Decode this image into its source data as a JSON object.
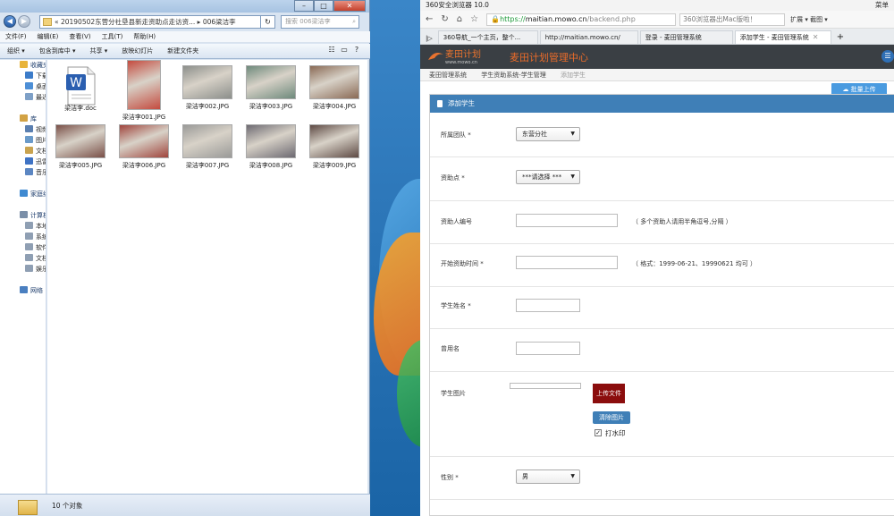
{
  "explorer": {
    "address_path": "« 20190502东营分社垦县新走资助点走访资... ▸ 006梁洁李",
    "search_placeholder": "搜索 006梁洁李",
    "menu": [
      "文件(F)",
      "编辑(E)",
      "查看(V)",
      "工具(T)",
      "帮助(H)"
    ],
    "toolbar": [
      "组织 ▾",
      "包含到库中 ▾",
      "共享 ▾",
      "放映幻灯片",
      "新建文件夹"
    ],
    "nav": [
      {
        "label": "收藏夹",
        "group": true,
        "color": "#e8b43a"
      },
      {
        "label": "下载",
        "group": false,
        "color": "#3c7cc9"
      },
      {
        "label": "桌面",
        "group": false,
        "color": "#4d8fd6"
      },
      {
        "label": "最近",
        "group": false,
        "color": "#7ea0c7"
      },
      {
        "label": "",
        "group": false,
        "color": "transparent"
      },
      {
        "label": "库",
        "group": true,
        "color": "#d2a244"
      },
      {
        "label": "视频",
        "group": false,
        "color": "#5a7fb0"
      },
      {
        "label": "图片",
        "group": false,
        "color": "#6a9ac9"
      },
      {
        "label": "文档",
        "group": false,
        "color": "#c9a34f"
      },
      {
        "label": "迅雷",
        "group": false,
        "color": "#3f73c4"
      },
      {
        "label": "音乐",
        "group": false,
        "color": "#5b86c2"
      },
      {
        "label": "",
        "group": false,
        "color": "transparent"
      },
      {
        "label": "家庭组",
        "group": true,
        "color": "#3f8ad1"
      },
      {
        "label": "",
        "group": false,
        "color": "transparent"
      },
      {
        "label": "计算机",
        "group": true,
        "color": "#7b8fa8"
      },
      {
        "label": "本地",
        "group": false,
        "color": "#8f9fb3"
      },
      {
        "label": "系统",
        "group": false,
        "color": "#8f9fb3"
      },
      {
        "label": "软件",
        "group": false,
        "color": "#8f9fb3"
      },
      {
        "label": "文档",
        "group": false,
        "color": "#8f9fb3"
      },
      {
        "label": "娱乐",
        "group": false,
        "color": "#8f9fb3"
      },
      {
        "label": "",
        "group": false,
        "color": "transparent"
      },
      {
        "label": "网络",
        "group": true,
        "color": "#4a7fc0"
      }
    ],
    "files": [
      {
        "name": "梁洁李.doc",
        "kind": "doc"
      },
      {
        "name": "梁洁李001.JPG",
        "kind": "photo",
        "color": "#c44b3f"
      },
      {
        "name": "梁洁李002.JPG",
        "kind": "photo",
        "color": "#8c8f8b"
      },
      {
        "name": "梁洁李003.JPG",
        "kind": "photo",
        "color": "#6e8a7c"
      },
      {
        "name": "梁洁李004.JPG",
        "kind": "photo",
        "color": "#8a6a55"
      },
      {
        "name": "梁洁李005.JPG",
        "kind": "photo",
        "color": "#7a5048"
      },
      {
        "name": "梁洁李006.JPG",
        "kind": "photo",
        "color": "#a0453d"
      },
      {
        "name": "梁洁李007.JPG",
        "kind": "photo",
        "color": "#9a9a98"
      },
      {
        "name": "梁洁李008.JPG",
        "kind": "photo",
        "color": "#6d6a72"
      },
      {
        "name": "梁洁李009.JPG",
        "kind": "photo",
        "color": "#5e4a44"
      }
    ],
    "status": "10 个对象"
  },
  "browser": {
    "title": "360安全浏览器 10.0",
    "title_right": "菜单",
    "url_scheme": "https://",
    "url_domain": "maitian.mowo.cn",
    "url_path": "/backend.php",
    "search_text": "360浏览器出Mac版啦！",
    "ext_text": "扩展 ▾  截图 ▾",
    "tabs": [
      "360导航_一个主页，整个...",
      "http://maitian.mowo.cn/",
      "登录 - 麦田管理系统",
      "添加学生 - 麦田管理系统"
    ]
  },
  "app": {
    "logo_text": "麦田计划",
    "logo_url": "www.mowo.cn",
    "title": "麦田计划管理中心",
    "breadcrumbs": [
      "麦田管理系统",
      "学生资助系统-学生管理",
      "添加学生"
    ],
    "batch_upload": "批量上传",
    "panel_title": "添加学生",
    "form": {
      "team_label": "所属团队 *",
      "team_value": "东营分社",
      "point_label": "资助点 *",
      "point_value": "***请选择 ***",
      "sponsor_label": "资助人编号",
      "sponsor_hint": "（ 多个资助人请用半角逗号,分隔 ）",
      "start_label": "开始资助时间 *",
      "start_hint": "（ 格式：1999-06-21、19990621 均可 ）",
      "name_label": "学生姓名 *",
      "alias_label": "曾用名",
      "photo_label": "学生图片",
      "upload_btn": "上传文件",
      "clear_btn": "清除图片",
      "watermark_label": "打水印",
      "gender_label": "性别 *",
      "gender_value": "男"
    }
  }
}
